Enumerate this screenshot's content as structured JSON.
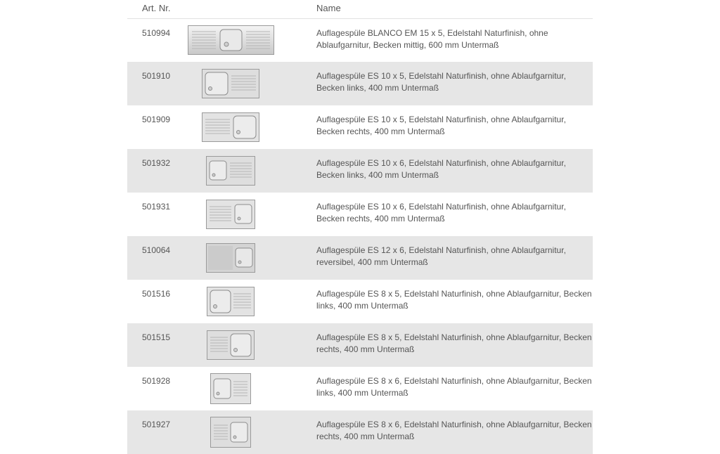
{
  "table": {
    "headers": {
      "art_nr": "Art. Nr.",
      "name": "Name"
    },
    "rows": [
      {
        "art": "510994",
        "name": "Auflagespüle BLANCO EM 15 x 5, Edelstahl Naturfinish, ohne Ablaufgarnitur, Becken mittig, 600 mm Untermaß",
        "image": "sink-center-bowl"
      },
      {
        "art": "501910",
        "name": "Auflagespüle ES 10 x 5, Edelstahl Naturfinish, ohne Ablaufgarnitur, Becken links, 400 mm Untermaß",
        "image": "sink-left-bowl"
      },
      {
        "art": "501909",
        "name": "Auflagespüle ES 10 x 5, Edelstahl Naturfinish, ohne Ablaufgarnitur, Becken rechts, 400 mm Untermaß",
        "image": "sink-right-bowl"
      },
      {
        "art": "501932",
        "name": "Auflagespüle ES 10 x 6, Edelstahl Naturfinish, ohne Ablaufgarnitur, Becken links, 400 mm Untermaß",
        "image": "sink-left-bowl"
      },
      {
        "art": "501931",
        "name": "Auflagespüle ES 10 x 6, Edelstahl Naturfinish, ohne Ablaufgarnitur, Becken rechts, 400 mm Untermaß",
        "image": "sink-right-bowl"
      },
      {
        "art": "510064",
        "name": "Auflagespüle ES 12 x 6, Edelstahl Naturfinish, ohne Ablaufgarnitur, reversibel, 400 mm Untermaß",
        "image": "sink-right-bowl-reversible"
      },
      {
        "art": "501516",
        "name": "Auflagespüle ES 8 x 5, Edelstahl Naturfinish, ohne Ablaufgarnitur, Becken links, 400 mm Untermaß",
        "image": "sink-left-bowl"
      },
      {
        "art": "501515",
        "name": "Auflagespüle ES 8 x 5, Edelstahl Naturfinish, ohne Ablaufgarnitur, Becken rechts, 400 mm Untermaß",
        "image": "sink-right-bowl"
      },
      {
        "art": "501928",
        "name": "Auflagespüle ES 8 x 6, Edelstahl Naturfinish, ohne Ablaufgarnitur, Becken links, 400 mm Untermaß",
        "image": "sink-left-bowl"
      },
      {
        "art": "501927",
        "name": "Auflagespüle ES 8 x 6, Edelstahl Naturfinish, ohne Ablaufgarnitur, Becken rechts, 400 mm Untermaß",
        "image": "sink-right-bowl"
      }
    ]
  },
  "colors": {
    "row_alt": "#e6e6e6",
    "text": "#555555",
    "divider": "#e2e2e2"
  }
}
